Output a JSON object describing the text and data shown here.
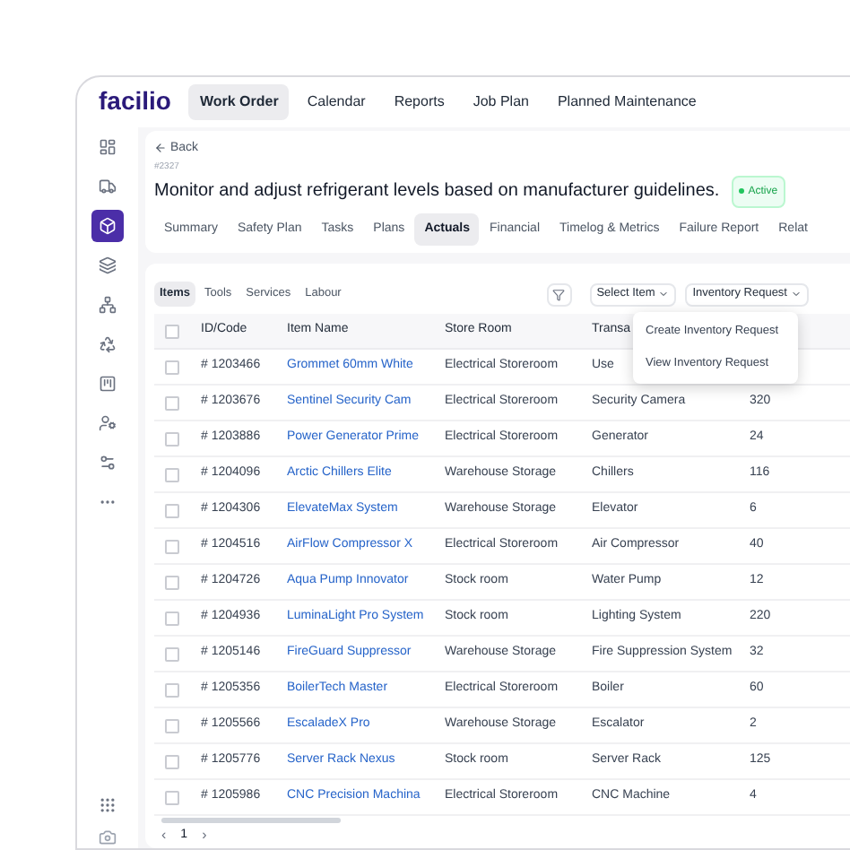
{
  "app": {
    "logo": "facilio",
    "nav": [
      {
        "label": "Work Order",
        "selected": true
      },
      {
        "label": "Calendar",
        "selected": false
      },
      {
        "label": "Reports",
        "selected": false
      },
      {
        "label": "Job Plan",
        "selected": false
      },
      {
        "label": "Planned Maintenance",
        "selected": false
      }
    ]
  },
  "sidebar": {
    "items": [
      {
        "selected": false
      },
      {
        "selected": false
      },
      {
        "selected": true
      },
      {
        "selected": false
      },
      {
        "selected": false
      },
      {
        "selected": false
      },
      {
        "selected": false
      },
      {
        "selected": false
      },
      {
        "selected": false
      },
      {
        "selected": false
      }
    ]
  },
  "header": {
    "back": "Back",
    "number": "#2327",
    "title": "Monitor and adjust refrigerant levels based on manufacturer guidelines.",
    "status": "Active"
  },
  "tabs": [
    {
      "label": "Summary",
      "selected": false
    },
    {
      "label": "Safety Plan",
      "selected": false
    },
    {
      "label": "Tasks",
      "selected": false
    },
    {
      "label": "Plans",
      "selected": false
    },
    {
      "label": "Actuals",
      "selected": true
    },
    {
      "label": "Financial",
      "selected": false
    },
    {
      "label": "Timelog & Metrics",
      "selected": false
    },
    {
      "label": "Failure Report",
      "selected": false
    },
    {
      "label": "Relat",
      "selected": false
    }
  ],
  "subtabs": [
    {
      "label": "Items",
      "selected": true
    },
    {
      "label": "Tools",
      "selected": false
    },
    {
      "label": "Services",
      "selected": false
    },
    {
      "label": "Labour",
      "selected": false
    }
  ],
  "toolbar": {
    "select_item": "Select Item",
    "inventory_request": "Inventory Request"
  },
  "menu": [
    "Create Inventory Request",
    "View Inventory Request"
  ],
  "table": {
    "all_checked": false,
    "columns": [
      "ID/Code",
      "Item Name",
      "Store Room",
      "Transa"
    ],
    "rows": [
      {
        "checked": false,
        "id": "# 1203466",
        "name": "Grommet 60mm White",
        "store": "Electrical Storeroom",
        "transaction": "Use"
      },
      {
        "checked": false,
        "id": "# 1203676",
        "name": "Sentinel Security Cam",
        "store": "Electrical Storeroom",
        "transaction": "Security Camera",
        "column_5": "320"
      },
      {
        "checked": false,
        "id": "# 1203886",
        "name": "Power Generator Prime",
        "store": "Electrical Storeroom",
        "transaction": "Generator",
        "column_5": "24"
      },
      {
        "checked": false,
        "id": "# 1204096",
        "name": "Arctic Chillers Elite",
        "store": "Warehouse Storage",
        "transaction": "Chillers",
        "column_5": "116"
      },
      {
        "checked": false,
        "id": "# 1204306",
        "name": "ElevateMax System",
        "store": "Warehouse Storage",
        "transaction": "Elevator",
        "column_5": "6"
      },
      {
        "checked": false,
        "id": "# 1204516",
        "name": "AirFlow Compressor X",
        "store": "Electrical Storeroom",
        "transaction": "Air Compressor",
        "column_5": "40"
      },
      {
        "checked": false,
        "id": "# 1204726",
        "name": "Aqua Pump Innovator",
        "store": "Stock room",
        "transaction": "Water Pump",
        "column_5": "12"
      },
      {
        "checked": false,
        "id": "# 1204936",
        "name": "LuminaLight Pro System",
        "store": "Stock room",
        "transaction": "Lighting System",
        "column_5": "220"
      },
      {
        "checked": false,
        "id": "# 1205146",
        "name": "FireGuard Suppressor",
        "store": "Warehouse Storage",
        "transaction": "Fire Suppression System",
        "column_5": "32"
      },
      {
        "checked": false,
        "id": "# 1205356",
        "name": "BoilerTech Master",
        "store": "Electrical Storeroom",
        "transaction": "Boiler",
        "column_5": "60"
      },
      {
        "checked": false,
        "id": "# 1205566",
        "name": "EscaladeX Pro",
        "store": "Warehouse Storage",
        "transaction": "Escalator",
        "column_5": "2"
      },
      {
        "checked": false,
        "id": "# 1205776",
        "name": "Server Rack Nexus",
        "store": "Stock room",
        "transaction": "Server Rack",
        "column_5": "125"
      },
      {
        "checked": false,
        "id": "# 1205986",
        "name": "CNC Precision Machina",
        "store": "Electrical Storeroom",
        "transaction": "CNC Machine",
        "column_5": "4"
      }
    ]
  },
  "pagination": {
    "prev": "‹",
    "page": "1",
    "next": "›"
  }
}
